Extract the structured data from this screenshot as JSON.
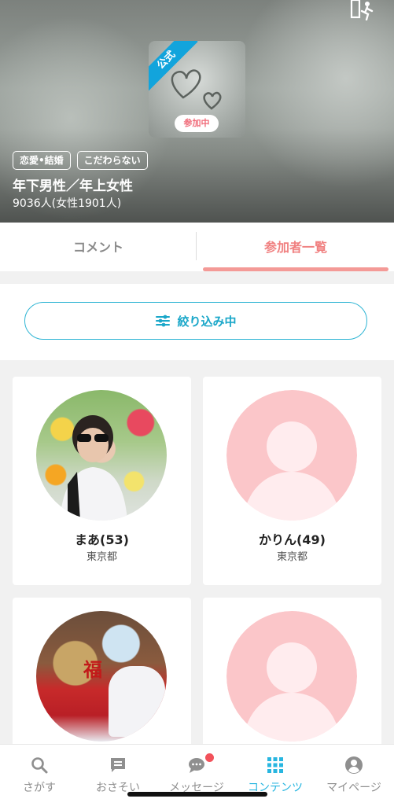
{
  "header": {
    "official_label": "公式",
    "joined_label": "参加中",
    "tags": [
      "恋愛•結婚",
      "こだわらない"
    ],
    "title": "年下男性／年上女性",
    "member_count": "9036人(女性1901人)"
  },
  "tabs": {
    "comment": "コメント",
    "participants": "参加者一覧",
    "active": "participants"
  },
  "filter": {
    "label": "絞り込み中"
  },
  "members": [
    {
      "name": "まあ(53)",
      "area": "東京都",
      "has_photo": true
    },
    {
      "name": "かりん(49)",
      "area": "東京都",
      "has_photo": false
    },
    {
      "name": "",
      "area": "",
      "has_photo": true
    },
    {
      "name": "",
      "area": "",
      "has_photo": false
    }
  ],
  "photo_text": "福",
  "nav": [
    {
      "label": "さがす",
      "icon": "search-icon"
    },
    {
      "label": "おさそい",
      "icon": "invite-icon"
    },
    {
      "label": "メッセージ",
      "icon": "message-icon",
      "badge": "!"
    },
    {
      "label": "コンテンツ",
      "icon": "grid-icon",
      "active": true
    },
    {
      "label": "マイページ",
      "icon": "profile-icon"
    }
  ],
  "colors": {
    "accent_pink": "#f08080",
    "accent_blue": "#28b6e0",
    "placeholder_pink": "#fbc6c9"
  }
}
